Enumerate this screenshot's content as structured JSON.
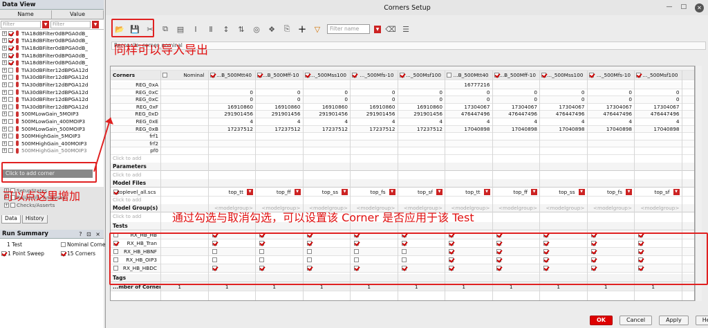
{
  "dv": {
    "title": "Data View",
    "controls": "? ⊡ ×",
    "col_name": "Name",
    "col_value": "Value",
    "filter": "Filter",
    "items": [
      {
        "label": "TIA18dBFilter0dBPGA0dB_",
        "on": true,
        "gray": false
      },
      {
        "label": "TIA18dBFilter0dBPGA0dB_",
        "on": true,
        "gray": false
      },
      {
        "label": "TIA18dBFilter0dBPGA0dB_",
        "on": true,
        "gray": false
      },
      {
        "label": "TIA18dBFilter0dBPGA0dB_",
        "on": true,
        "gray": false
      },
      {
        "label": "TIA18dBFilter0dBPGA0dB_",
        "on": true,
        "gray": false
      },
      {
        "label": "TIA30dBFilter12dBPGA12d",
        "on": false,
        "gray": false
      },
      {
        "label": "TIA30dBFilter12dBPGA12d",
        "on": false,
        "gray": false
      },
      {
        "label": "TIA30dBFilter12dBPGA12d",
        "on": false,
        "gray": false
      },
      {
        "label": "TIA30dBFilter12dBPGA12d",
        "on": false,
        "gray": false
      },
      {
        "label": "TIA30dBFilter12dBPGA12d",
        "on": false,
        "gray": false
      },
      {
        "label": "TIA30dBFilter12dBPGA12d",
        "on": false,
        "gray": false
      },
      {
        "label": "500MLowGain_5MOIP3",
        "on": false,
        "gray": false
      },
      {
        "label": "500MLowGain_400MOIP3",
        "on": false,
        "gray": false
      },
      {
        "label": "500MLowGain_500MOIP3",
        "on": false,
        "gray": false
      },
      {
        "label": "500MHighGain_5MOIP3",
        "on": false,
        "gray": false
      },
      {
        "label": "500MHighGain_400MOIP3",
        "on": false,
        "gray": false
      },
      {
        "label": "500MHighGain_500MOIP3",
        "on": false,
        "gray": true
      }
    ],
    "add_corner": "Click to add corner",
    "extra": [
      "SetupStates",
      "Reliability Analyses",
      "Checks/Asserts"
    ],
    "tab_data": "Data",
    "tab_history": "History"
  },
  "rs": {
    "title": "Run Summary",
    "controls": "? ⊡ ×",
    "test_count": "1 Test",
    "nominal": "Nominal Corner",
    "sweep": "1 Point Sweep",
    "corners": "15 Corners"
  },
  "win": {
    "title": "Corners Setup",
    "filter_placeholder": "Filter name",
    "corner_bar": "Reconcile: corner_nominal",
    "ok": "OK",
    "cancel": "Cancel",
    "apply": "Apply",
    "help": "Help"
  },
  "grid": {
    "corners_label": "Corners",
    "columns": [
      "Nominal",
      "...B_500Mtt40",
      "...B_500Mff-10",
      "..._500Mss100",
      "..._500Mfs-10",
      "..._500Msf100",
      "...B_500Mtt40",
      "...B_500Mff-10",
      "..._500Mss100",
      "..._500Mfs-10",
      "..._500Msf100"
    ],
    "col_on": [
      false,
      true,
      true,
      true,
      true,
      true,
      false,
      true,
      true,
      true,
      true
    ],
    "vars": [
      {
        "name": "REG_0xA",
        "vals": [
          "",
          "",
          "",
          "",
          "",
          "",
          "16777216",
          "",
          "",
          "",
          ""
        ]
      },
      {
        "name": "REG_0xC",
        "vals": [
          "",
          "0",
          "0",
          "0",
          "0",
          "0",
          "0",
          "0",
          "0",
          "0",
          "0"
        ]
      },
      {
        "name": "REG_0xC",
        "vals": [
          "",
          "0",
          "0",
          "0",
          "0",
          "0",
          "0",
          "0",
          "0",
          "0",
          "0"
        ]
      },
      {
        "name": "REG_0xF",
        "vals": [
          "",
          "16910860",
          "16910860",
          "16910860",
          "16910860",
          "16910860",
          "17304067",
          "17304067",
          "17304067",
          "17304067",
          "17304067"
        ]
      },
      {
        "name": "REG_0xD",
        "vals": [
          "",
          "291901456",
          "291901456",
          "291901456",
          "291901456",
          "291901456",
          "476447496",
          "476447496",
          "476447496",
          "476447496",
          "476447496"
        ]
      },
      {
        "name": "REG_0xE",
        "vals": [
          "",
          "4",
          "4",
          "4",
          "4",
          "4",
          "4",
          "4",
          "4",
          "4",
          "4"
        ]
      },
      {
        "name": "REG_0xB",
        "vals": [
          "",
          "17237512",
          "17237512",
          "17237512",
          "17237512",
          "17237512",
          "17040898",
          "17040898",
          "17040898",
          "17040898",
          "17040898"
        ]
      },
      {
        "name": "frf1",
        "vals": [
          "",
          "",
          "",
          "",
          "",
          "",
          "",
          "",
          "",
          "",
          ""
        ]
      },
      {
        "name": "frf2",
        "vals": [
          "",
          "",
          "",
          "",
          "",
          "",
          "",
          "",
          "",
          "",
          ""
        ]
      },
      {
        "name": "pf0",
        "vals": [
          "",
          "",
          "",
          "",
          "",
          "",
          "",
          "",
          "",
          "",
          ""
        ]
      }
    ],
    "click_to_add": "Click to add",
    "parameters": "Parameters",
    "model_files": "Model Files",
    "model_file": "toplevel_all.scs",
    "sections": [
      "tt",
      "ff",
      "ss",
      "fs",
      "sf",
      "tt",
      "ff",
      "ss",
      "fs",
      "sf"
    ],
    "model_groups": "Model Group(s)",
    "model_group_val": "<modelgroup>",
    "tests_label": "Tests",
    "tests": [
      {
        "name": "RX_HB_HB",
        "on": false,
        "vals": [
          true,
          true,
          true,
          true,
          true,
          true,
          true,
          true,
          true,
          true
        ]
      },
      {
        "name": "RX_HB_Tran",
        "on": true,
        "vals": [
          true,
          true,
          true,
          true,
          true,
          true,
          true,
          true,
          true,
          true
        ]
      },
      {
        "name": "RX_HB_HBNF",
        "on": false,
        "vals": [
          false,
          false,
          false,
          false,
          false,
          true,
          true,
          true,
          true,
          true
        ]
      },
      {
        "name": "RX_HB_OIP3",
        "on": false,
        "vals": [
          false,
          false,
          false,
          false,
          false,
          true,
          true,
          true,
          true,
          true
        ]
      },
      {
        "name": "RX_HB_HBDC",
        "on": false,
        "vals": [
          true,
          true,
          true,
          true,
          true,
          true,
          true,
          true,
          true,
          true
        ]
      }
    ],
    "tags": "Tags",
    "num_corners_label": "...mber of Corners",
    "num_corners": [
      "1",
      "1",
      "1",
      "1",
      "1",
      "1",
      "1",
      "1",
      "1",
      "1",
      "1"
    ]
  },
  "annotations": {
    "import_export": "同样可以导入导出",
    "add_here": "可以点这里增加",
    "toggle": "通过勾选与取消勾选，可以设置该 Corner 是否应用于该 Test"
  }
}
